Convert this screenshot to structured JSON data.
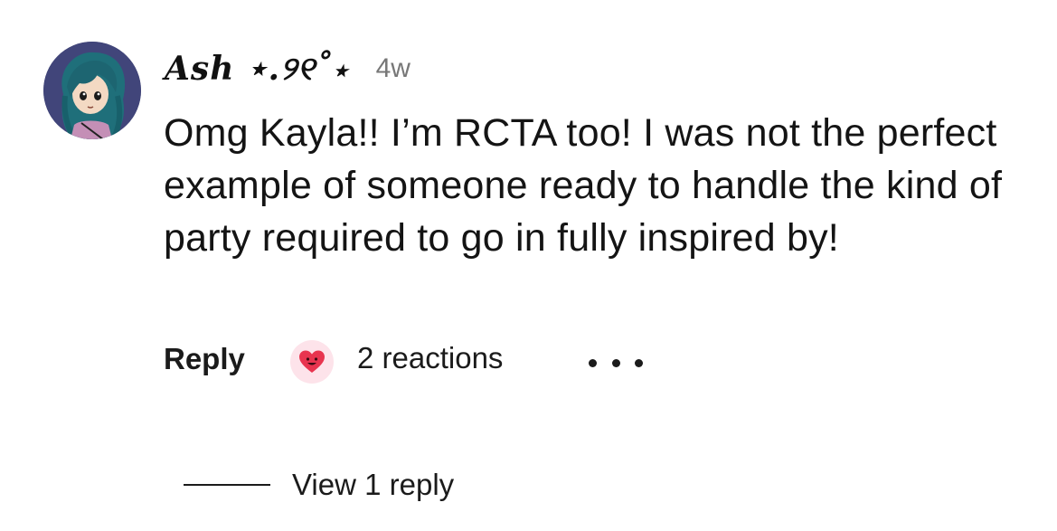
{
  "comment": {
    "author": "Ash ⋆.୨୧˚⋆",
    "timestamp": "4w",
    "text": "Omg Kayla!! I’m RCTA too! I was not the perfect example of someone ready to handle the kind of party required to go in fully inspired by!",
    "avatar_icon": "anime-character-avatar"
  },
  "actions": {
    "reply_label": "Reply",
    "reaction_icon": "heart-face-icon",
    "reactions_label": "2 reactions",
    "more_icon": "more-options-icon"
  },
  "replies": {
    "view_label": "View 1 reply"
  },
  "colors": {
    "reaction_bubble": "#fde3ea",
    "heart": "#e8344f",
    "timestamp": "#777777"
  }
}
